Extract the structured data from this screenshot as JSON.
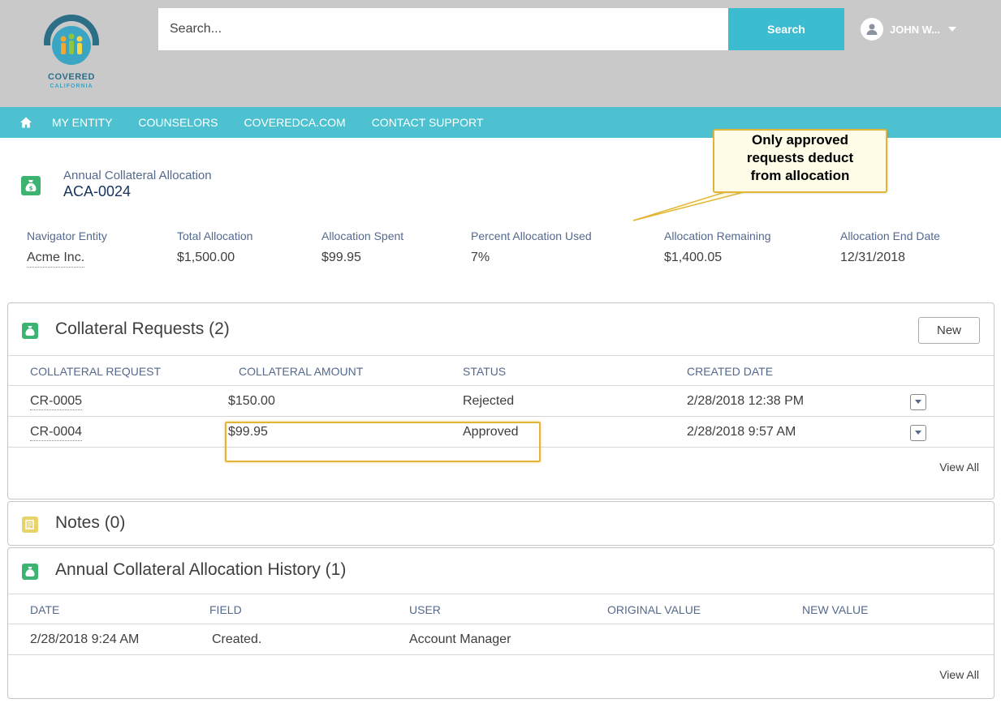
{
  "header": {
    "logo_line1": "COVERED",
    "logo_line2": "CALIFORNIA",
    "search_placeholder": "Search...",
    "search_button": "Search",
    "user_name": "JOHN W...",
    "accent_color": "#3bbcd0"
  },
  "nav": {
    "items": [
      "MY ENTITY",
      "COUNSELORS",
      "COVEREDCA.COM",
      "CONTACT SUPPORT"
    ]
  },
  "record": {
    "type": "Annual Collateral Allocation",
    "name": "ACA-0024",
    "fields": [
      {
        "label": "Navigator Entity",
        "value": "Acme Inc."
      },
      {
        "label": "Total Allocation",
        "value": "$1,500.00"
      },
      {
        "label": "Allocation Spent",
        "value": "$99.95"
      },
      {
        "label": "Percent Allocation Used",
        "value": "7%"
      },
      {
        "label": "Allocation Remaining",
        "value": "$1,400.05"
      },
      {
        "label": "Allocation End Date",
        "value": "12/31/2018"
      }
    ]
  },
  "callout": {
    "line1": "Only approved",
    "line2": "requests deduct",
    "line3": "from allocation"
  },
  "requests": {
    "title": "Collateral Requests (2)",
    "new_button": "New",
    "columns": [
      "COLLATERAL REQUEST",
      "COLLATERAL AMOUNT",
      "STATUS",
      "CREATED DATE"
    ],
    "rows": [
      [
        "CR-0005",
        "$150.00",
        "Rejected",
        "2/28/2018 12:38 PM"
      ],
      [
        "CR-0004",
        "$99.95",
        "Approved",
        "2/28/2018 9:57 AM"
      ]
    ],
    "view_all": "View All"
  },
  "notes": {
    "title": "Notes (0)"
  },
  "history": {
    "title": "Annual Collateral Allocation History (1)",
    "columns": [
      "DATE",
      "FIELD",
      "USER",
      "ORIGINAL VALUE",
      "NEW VALUE"
    ],
    "rows": [
      [
        "2/28/2018 9:24 AM",
        "Created.",
        "Account Manager",
        "",
        ""
      ]
    ],
    "view_all": "View All"
  }
}
